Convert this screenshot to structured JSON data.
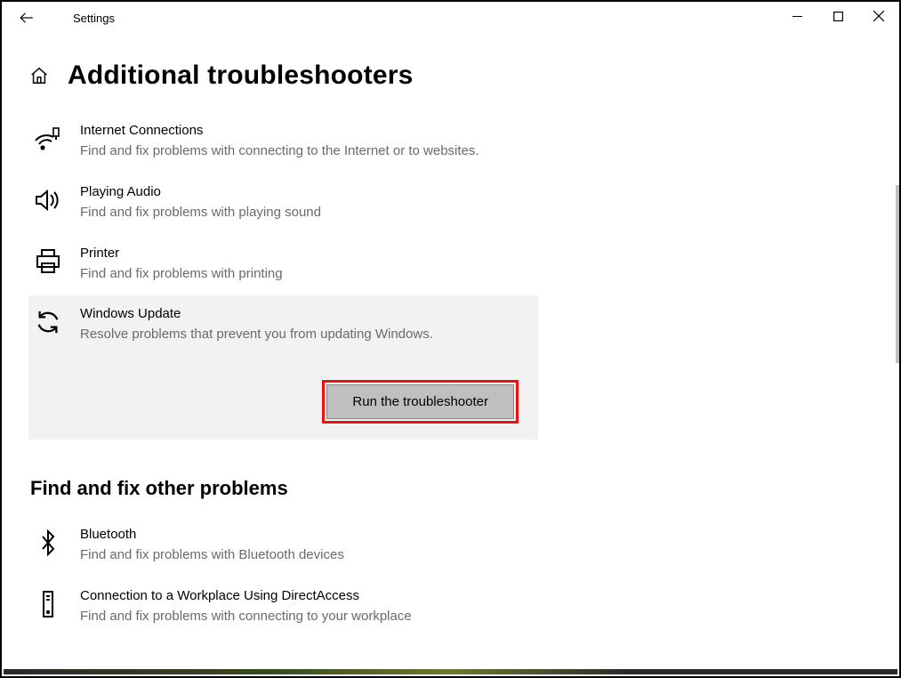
{
  "titlebar": {
    "app": "Settings"
  },
  "page": {
    "title": "Additional troubleshooters"
  },
  "items": [
    {
      "title": "Internet Connections",
      "desc": "Find and fix problems with connecting to the Internet or to websites."
    },
    {
      "title": "Playing Audio",
      "desc": "Find and fix problems with playing sound"
    },
    {
      "title": "Printer",
      "desc": "Find and fix problems with printing"
    },
    {
      "title": "Windows Update",
      "desc": "Resolve problems that prevent you from updating Windows.",
      "run_label": "Run the troubleshooter"
    }
  ],
  "section2": {
    "heading": "Find and fix other problems"
  },
  "items2": [
    {
      "title": "Bluetooth",
      "desc": "Find and fix problems with Bluetooth devices"
    },
    {
      "title": "Connection to a Workplace Using DirectAccess",
      "desc": "Find and fix problems with connecting to your workplace"
    }
  ]
}
